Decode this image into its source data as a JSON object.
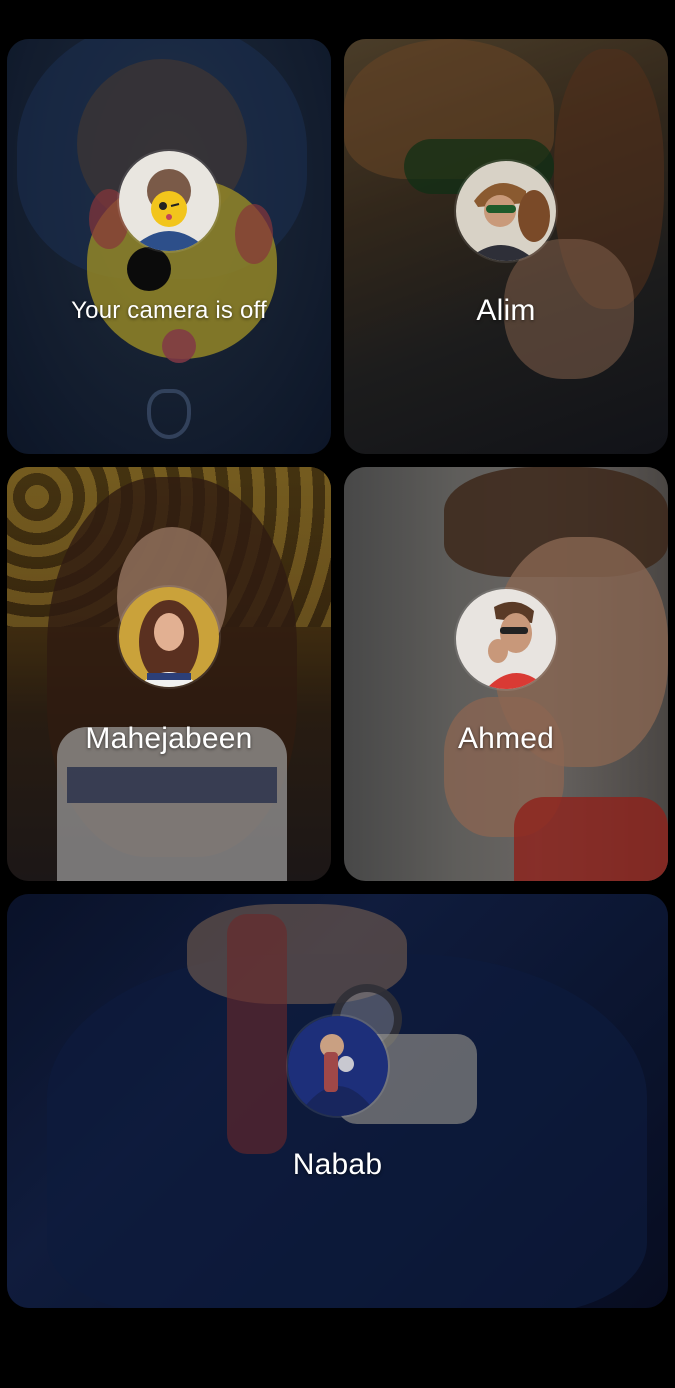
{
  "call": {
    "participants": [
      {
        "id": "self",
        "label": "Your camera is off",
        "avatar_icon": "self-avatar-icon"
      },
      {
        "id": "alim",
        "label": "Alim",
        "avatar_icon": "alim-avatar-icon"
      },
      {
        "id": "mahe",
        "label": "Mahejabeen",
        "avatar_icon": "mahejabeen-avatar-icon"
      },
      {
        "id": "ahmed",
        "label": "Ahmed",
        "avatar_icon": "ahmed-avatar-icon"
      },
      {
        "id": "nabab",
        "label": "Nabab",
        "avatar_icon": "nabab-avatar-icon"
      }
    ]
  },
  "colors": {
    "background": "#000000",
    "label_text": "#ffffff"
  }
}
